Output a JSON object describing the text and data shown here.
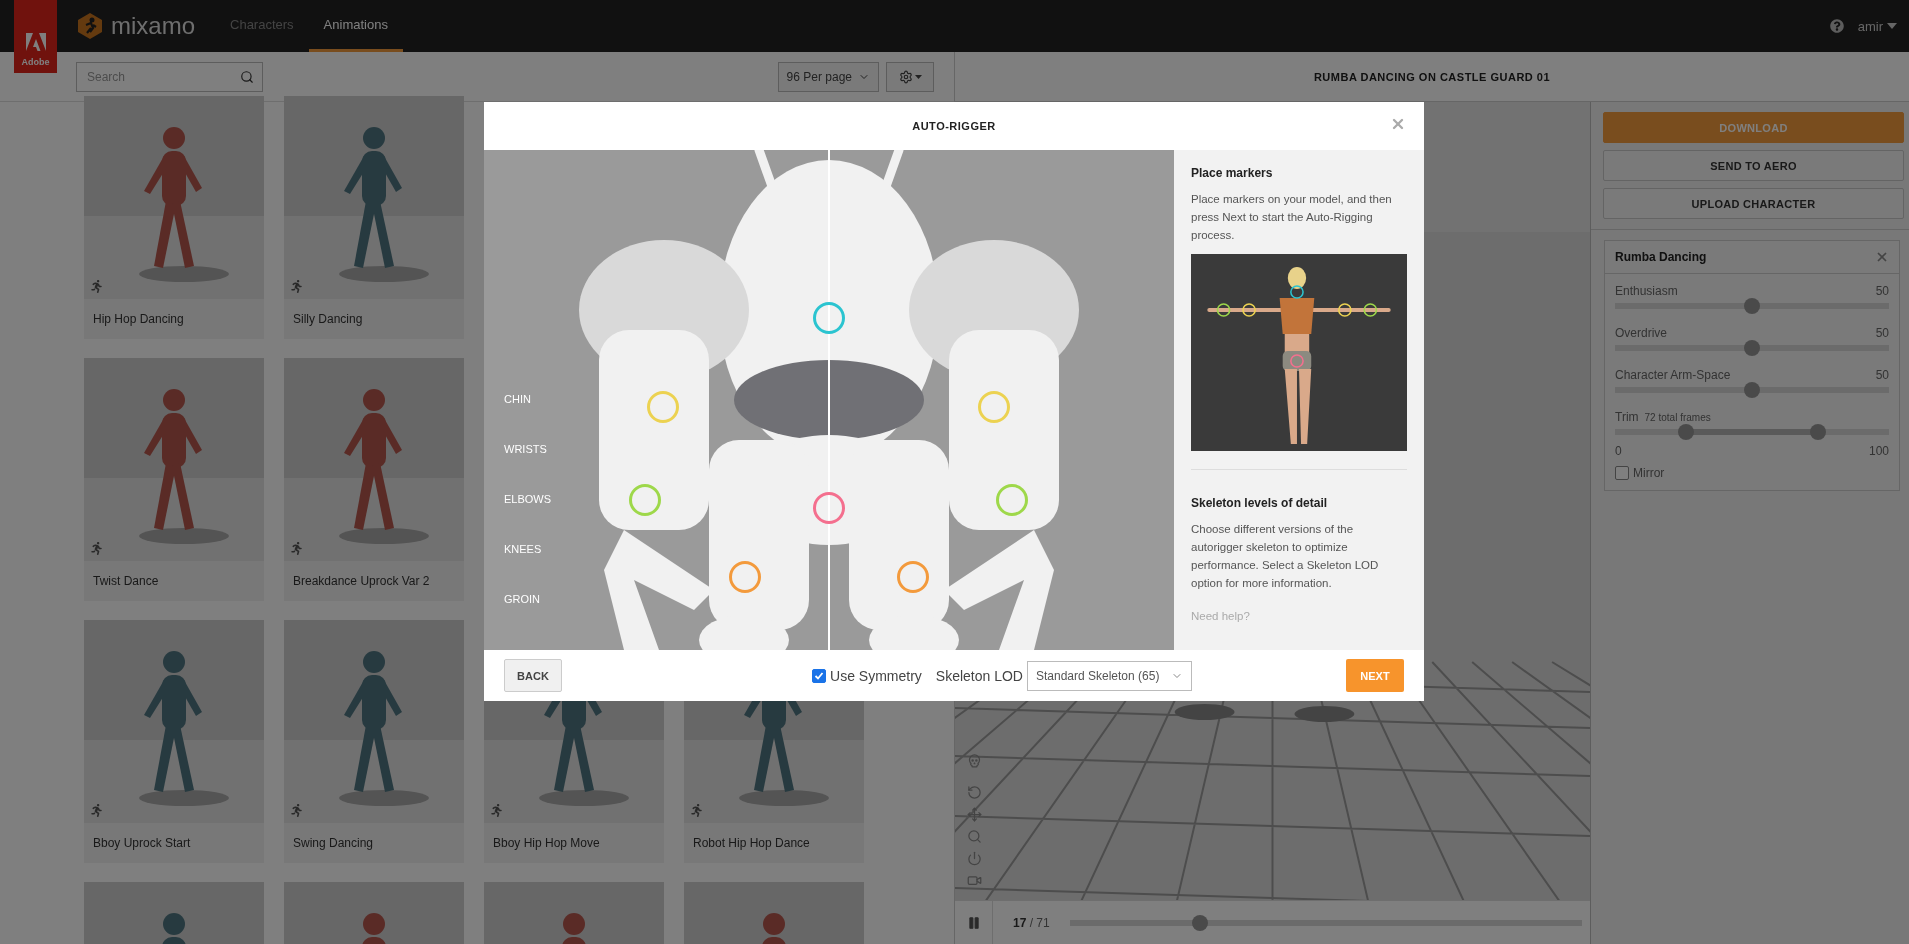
{
  "header": {
    "brand": "Adobe",
    "product": "mixamo",
    "nav": [
      {
        "label": "Characters",
        "selected": false
      },
      {
        "label": "Animations",
        "selected": true
      }
    ],
    "user": "amir"
  },
  "library": {
    "search": {
      "placeholder": "Search"
    },
    "per_page": "96 Per page",
    "rows": [
      [
        {
          "kind": "animation",
          "name": "Hip Hop Dancing"
        },
        {
          "kind": "animation",
          "name": "Silly Dancing"
        }
      ],
      [
        {
          "kind": "animation",
          "name": "Twist Dance"
        },
        {
          "kind": "animation",
          "name": "Breakdance Uprock Var 2"
        }
      ],
      [
        {
          "kind": "animation",
          "name": "Bboy Uprock Start"
        },
        {
          "kind": "animation",
          "name": "Swing Dancing"
        },
        {
          "kind": "animation",
          "name": "Bboy Hip Hop Move"
        },
        {
          "kind": "animation",
          "name": "Robot Hip Hop Dance"
        }
      ],
      [
        {
          "kind": "picture"
        },
        {
          "kind": "picture"
        },
        {
          "kind": "picture"
        },
        {
          "kind": "picture"
        }
      ]
    ]
  },
  "viewer": {
    "title": "RUMBA DANCING ON CASTLE GUARD 01",
    "playing": true,
    "frames": "**17** / 71",
    "scrub": {
      "level": 0.255
    }
  },
  "actions": [
    {
      "label": "DOWNLOAD",
      "kind": "primary"
    },
    {
      "label": "SEND TO AERO",
      "kind": "default"
    },
    {
      "label": "UPLOAD CHARACTER",
      "kind": "default"
    }
  ],
  "settings": {
    "title": "Rumba Dancing",
    "sliders": [
      {
        "label": "Enthusiasm",
        "value": "50",
        "level": 0.5
      },
      {
        "label": "Overdrive",
        "value": "50",
        "level": 0.5
      },
      {
        "label": "Character Arm-Space",
        "value": "50",
        "level": 0.5
      }
    ],
    "trim": {
      "label": "Trim",
      "note": "72 total frames",
      "start": {
        "level": 0.26
      },
      "end": {
        "level": 0.74
      },
      "min": "0",
      "max": "100"
    },
    "mirror": {
      "label": "Mirror",
      "checked": false
    }
  },
  "dialog": {
    "title": "AUTO-RIGGER",
    "marker_labels": [
      "CHIN",
      "WRISTS",
      "ELBOWS",
      "KNEES",
      "GROIN"
    ],
    "markers": [
      {
        "color": "#2bc4d0"
      },
      {
        "color": "#ecd251"
      },
      {
        "color": "#ecd251"
      },
      {
        "color": "#9ed84a"
      },
      {
        "color": "#9ed84a"
      },
      {
        "color": "#f46f8e"
      },
      {
        "color": "#f39a3c"
      },
      {
        "color": "#f39a3c"
      }
    ],
    "sections": [
      {
        "title": "Place markers",
        "text": "Place markers on your model, and then press Next to start the Auto-Rigging process."
      },
      {
        "title": "Skeleton levels of detail",
        "text": "Choose different versions of the autorigger skeleton to optimize performance. Select a Skeleton LOD option for more information."
      }
    ],
    "help_link": "Need help?",
    "back": "BACK",
    "symmetry": {
      "label": "Use Symmetry",
      "checked": true
    },
    "lod": {
      "label": "Skeleton LOD",
      "value": "Standard Skeleton (65)"
    },
    "next": "NEXT"
  }
}
